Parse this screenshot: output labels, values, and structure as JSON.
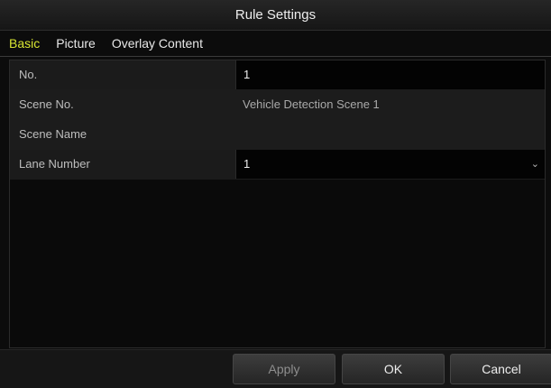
{
  "dialog": {
    "title": "Rule Settings"
  },
  "tabs": [
    {
      "label": "Basic",
      "active": true
    },
    {
      "label": "Picture",
      "active": false
    },
    {
      "label": "Overlay Content",
      "active": false
    }
  ],
  "fields": {
    "no": {
      "label": "No.",
      "value": "1"
    },
    "scene_no": {
      "label": "Scene No.",
      "value": "Vehicle Detection Scene 1"
    },
    "scene_name": {
      "label": "Scene Name",
      "value": ""
    },
    "lane_number": {
      "label": "Lane Number",
      "value": "1",
      "caret": "⌄"
    }
  },
  "buttons": {
    "apply": "Apply",
    "ok": "OK",
    "cancel": "Cancel"
  },
  "colors": {
    "active_tab": "#d8e632",
    "background": "#0c0c0c"
  }
}
